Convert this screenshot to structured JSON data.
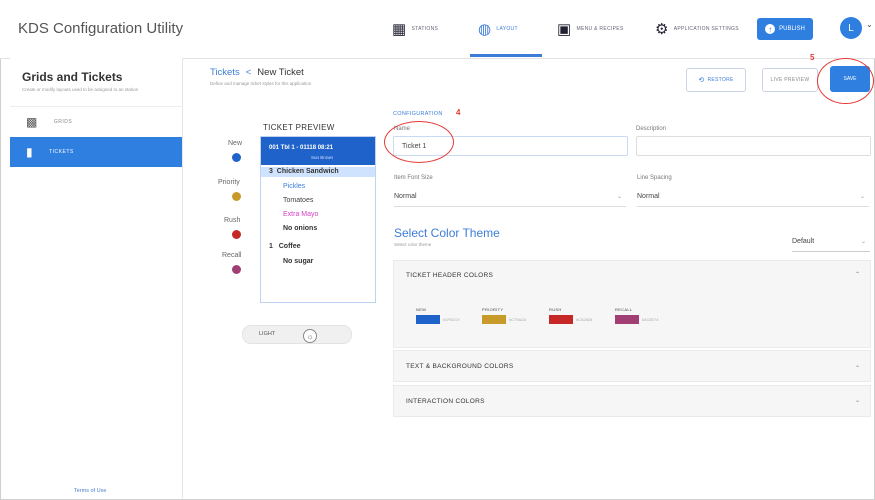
{
  "app": {
    "title": "KDS Configuration Utility"
  },
  "nav": [
    {
      "label": "STATIONS",
      "icon": "stations-icon"
    },
    {
      "label": "LAYOUT",
      "icon": "palette-icon",
      "active": true
    },
    {
      "label": "MENU & RECIPES",
      "icon": "menu-book-icon"
    },
    {
      "label": "APPLICATION SETTINGS",
      "icon": "gear-icon"
    }
  ],
  "publish": {
    "label": "PUBLISH"
  },
  "user": {
    "initial": "L"
  },
  "sidebar": {
    "title": "Grids and Tickets",
    "subtitle": "Create or modify layouts used to be assigned to an station",
    "items": [
      {
        "label": "GRIDS",
        "active": false
      },
      {
        "label": "TICKETS",
        "active": true
      }
    ],
    "terms": "Terms of Use"
  },
  "header": {
    "breadcrumb_parent": "Tickets",
    "breadcrumb_sep": "<",
    "breadcrumb_current": "New Ticket",
    "subtitle": "Define and manage ticket styles for this application",
    "restore_label": "RESTORE",
    "preview_label": "LIVE PREVIEW",
    "save_label": "SAVE"
  },
  "annotations": {
    "save_step": "5",
    "config_step": "4"
  },
  "preview": {
    "title": "TICKET PREVIEW",
    "header_line1": "001   Tbl 1 - 01118   08:21",
    "header_line2": "Sun Brown",
    "lines": [
      {
        "qty": "3",
        "text": "Chicken Sandwich",
        "style": "bold"
      },
      {
        "qty": "",
        "text": "Pickles",
        "style": "blue"
      },
      {
        "qty": "",
        "text": "Tomatoes",
        "style": "normal"
      },
      {
        "qty": "",
        "text": "Extra Mayo",
        "style": "magenta"
      },
      {
        "qty": "",
        "text": "No onions",
        "style": "bold"
      },
      {
        "qty": "1",
        "text": "Coffee",
        "style": "bold"
      },
      {
        "qty": "",
        "text": "No sugar",
        "style": "bold"
      }
    ],
    "legend": [
      {
        "label": "New",
        "color": "#1f62c9"
      },
      {
        "label": "Priority",
        "color": "#c79a2a"
      },
      {
        "label": "Rush",
        "color": "#c62828"
      },
      {
        "label": "Recall",
        "color": "#a13e74"
      }
    ],
    "toggle_label": "LIGHT"
  },
  "config": {
    "section_label": "CONFIGURATION",
    "name_label": "Name",
    "name_value": "Ticket 1",
    "description_label": "Description",
    "font_size_label": "Item Font Size",
    "font_size_value": "Normal",
    "line_spacing_label": "Line Spacing",
    "line_spacing_value": "Normal"
  },
  "theme": {
    "title": "Select Color Theme",
    "subtitle": "Select color theme",
    "selected": "Default",
    "panels": [
      {
        "title": "TICKET HEADER COLORS",
        "expanded": true
      },
      {
        "title": "TEXT & BACKGROUND COLORS",
        "expanded": false
      },
      {
        "title": "INTERACTION COLORS",
        "expanded": false
      }
    ],
    "swatches": [
      {
        "label": "NEW",
        "color": "#1f62c9",
        "hex": "#1F62C9"
      },
      {
        "label": "PRIORITY",
        "color": "#c79a2a",
        "hex": "#C79A2A"
      },
      {
        "label": "RUSH",
        "color": "#c62828",
        "hex": "#C62828"
      },
      {
        "label": "RECALL",
        "color": "#a13e74",
        "hex": "#A13E74"
      }
    ]
  }
}
